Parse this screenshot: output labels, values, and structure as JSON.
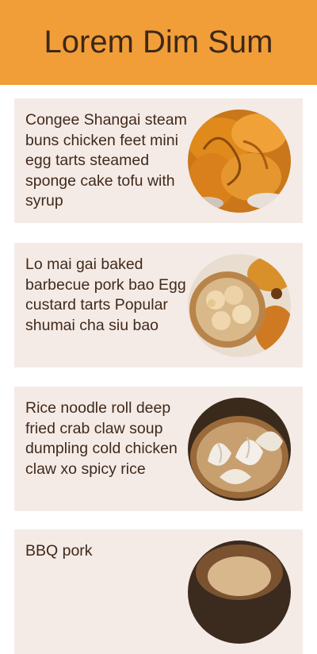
{
  "header": {
    "title": "Lorem Dim Sum",
    "background": "#f19e39",
    "title_color": "#3d2817"
  },
  "cards": [
    {
      "text": "Congee Shangai steam buns chicken feet mini egg tarts steamed sponge cake tofu with syrup",
      "image": "fried-dumplings-photo"
    },
    {
      "text": "Lo mai gai baked barbecue pork bao Egg custard tarts Popular shumai cha siu bao",
      "image": "steamer-buns-photo"
    },
    {
      "text": "Rice noodle roll deep fried crab claw soup dumpling cold chicken claw xo spicy rice",
      "image": "soup-dumplings-photo"
    },
    {
      "text": "BBQ pork",
      "image": "bbq-pork-photo"
    }
  ],
  "colors": {
    "card_background": "#f5ebe6",
    "text": "#3f2a1c"
  }
}
